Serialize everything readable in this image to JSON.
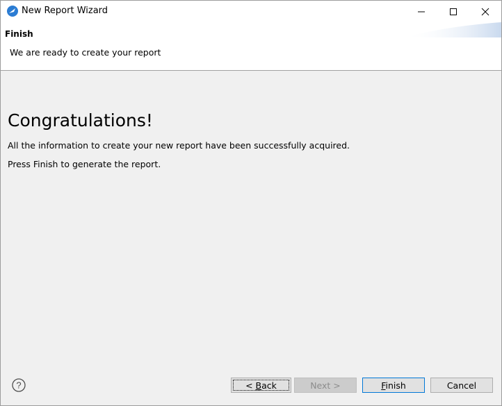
{
  "window": {
    "title": "New Report Wizard"
  },
  "banner": {
    "title": "Finish",
    "description": "We are ready to create your report"
  },
  "main": {
    "heading": "Congratulations!",
    "line1": "All the information to create your new report have been successfully acquired.",
    "line2": "Press Finish to generate the report."
  },
  "footer": {
    "back": {
      "prefix": "< ",
      "mnemonic": "B",
      "rest": "ack"
    },
    "next": "Next >",
    "finish": {
      "mnemonic": "F",
      "rest": "inish"
    },
    "cancel": "Cancel"
  },
  "colors": {
    "accent": "#0078d7",
    "disabled_text": "#8c8c8c",
    "app_icon": "#2b7cd3"
  },
  "icons": {
    "app": "eclipse-wizard-icon",
    "help": "help-icon",
    "minimize": "minimize-icon",
    "maximize": "maximize-icon",
    "close": "close-icon"
  }
}
